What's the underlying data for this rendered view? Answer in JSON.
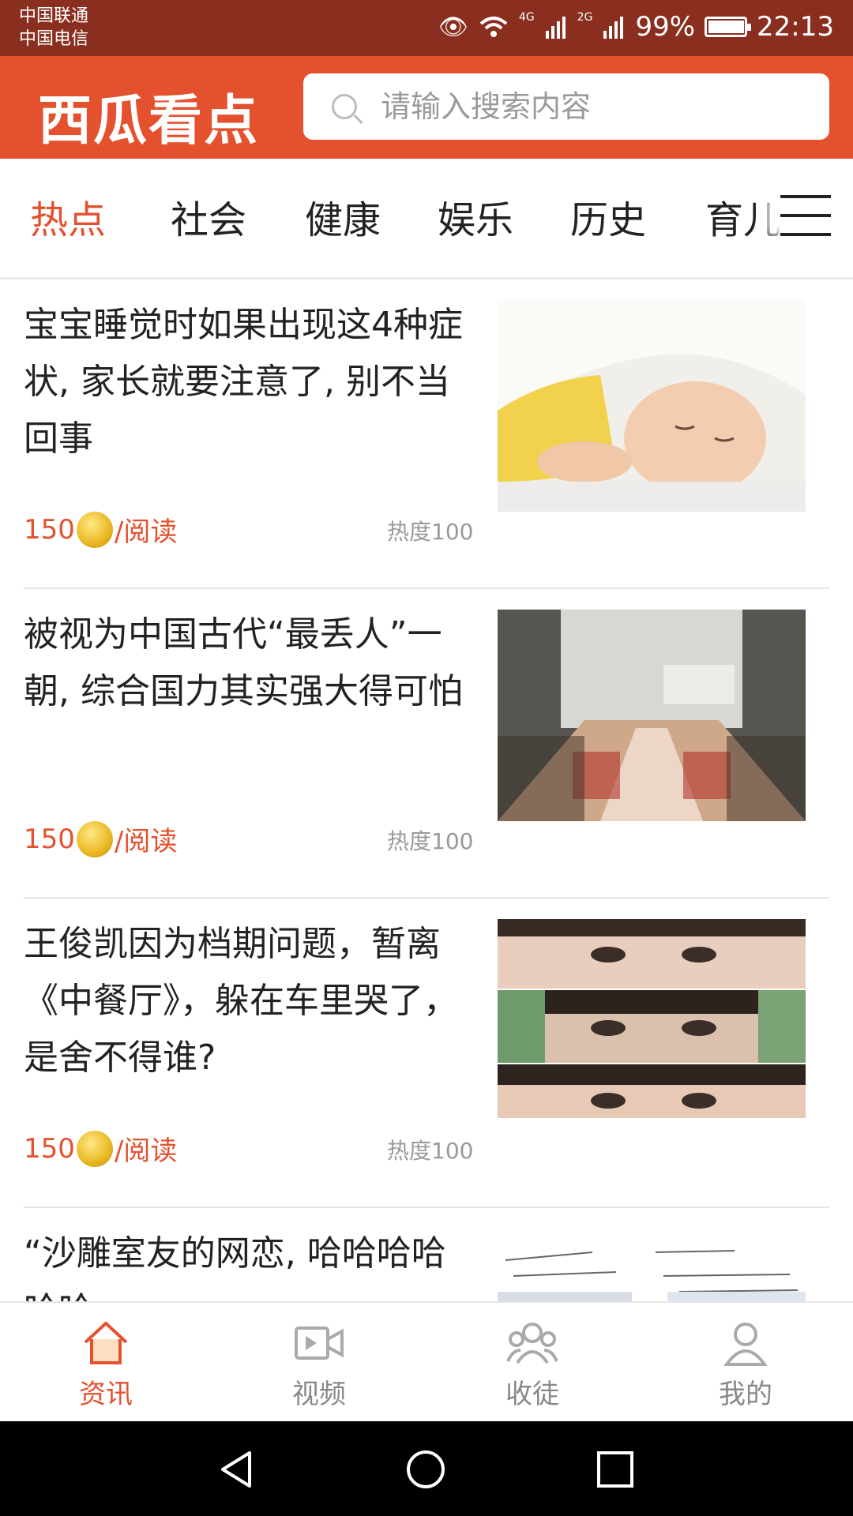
{
  "status": {
    "carrier1": "中国联通",
    "carrier2": "中国电信",
    "net1": "4G",
    "net2": "2G",
    "battery": "99%",
    "time": "22:13"
  },
  "header": {
    "logo": "西瓜看点",
    "search_placeholder": "请输入搜索内容"
  },
  "tabs": [
    "热点",
    "社会",
    "健康",
    "娱乐",
    "历史",
    "育儿"
  ],
  "articles": [
    {
      "title": "宝宝睡觉时如果出现这4种症状, 家长就要注意了, 别不当回事",
      "reward": "150",
      "reward_suffix": "/阅读",
      "hot": "热度100"
    },
    {
      "title": "被视为中国古代“最丢人”一朝, 综合国力其实强大得可怕",
      "reward": "150",
      "reward_suffix": "/阅读",
      "hot": "热度100"
    },
    {
      "title": "王俊凯因为档期问题，暂离《中餐厅》，躲在车里哭了，是舍不得谁?",
      "reward": "150",
      "reward_suffix": "/阅读",
      "hot": "热度100"
    },
    {
      "title": "“沙雕室友的网恋, 哈哈哈哈哈哈",
      "reward": "",
      "reward_suffix": "",
      "hot": ""
    }
  ],
  "bottom_nav": [
    {
      "label": "资讯",
      "icon": "home-icon"
    },
    {
      "label": "视频",
      "icon": "video-icon"
    },
    {
      "label": "收徒",
      "icon": "group-icon"
    },
    {
      "label": "我的",
      "icon": "user-icon"
    }
  ],
  "colors": {
    "brand": "#e4512f",
    "statusbar": "#8a2f1f"
  }
}
